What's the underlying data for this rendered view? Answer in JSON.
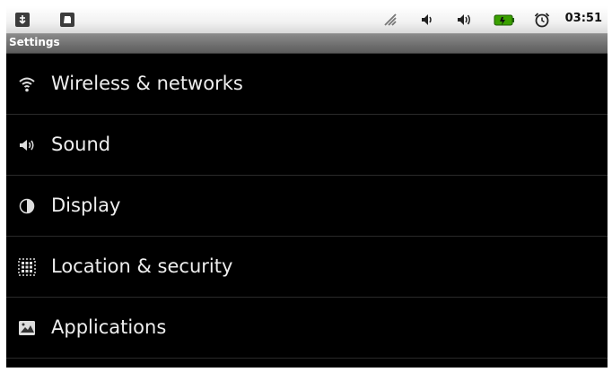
{
  "status_bar": {
    "time": "03:51",
    "left_icons": [
      "usb-icon",
      "sd-card-icon"
    ],
    "right_icons": [
      "signal-icon",
      "volume-icon",
      "volume-loud-icon",
      "battery-icon",
      "alarm-clock-icon"
    ],
    "battery_color": "#3aa000"
  },
  "title_bar": {
    "title": "Settings"
  },
  "settings": {
    "items": [
      {
        "label": "Wireless & networks",
        "icon": "wifi-icon"
      },
      {
        "label": "Sound",
        "icon": "sound-icon"
      },
      {
        "label": "Display",
        "icon": "display-icon"
      },
      {
        "label": "Location & security",
        "icon": "location-security-icon"
      },
      {
        "label": "Applications",
        "icon": "applications-icon"
      }
    ]
  }
}
